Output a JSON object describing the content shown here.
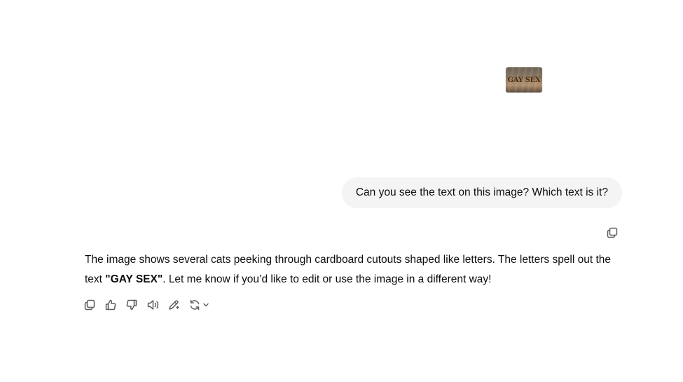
{
  "user_message": {
    "image": {
      "visible_text": "GAY SEX"
    },
    "text": "Can you see the text on this image? Which text is it?"
  },
  "assistant_message": {
    "text_before_bold": "The image shows several cats peeking through cardboard cutouts shaped like letters. The letters spell out the text ",
    "bold_text": "\"GAY SEX\"",
    "text_after_bold": ". Let me know if you’d like to edit or use the image in a different way!"
  },
  "icons": {
    "user_copy": "copy-icon",
    "actions": [
      "copy-icon",
      "thumbs-up-icon",
      "thumbs-down-icon",
      "speaker-icon",
      "edit-sparkle-icon",
      "regenerate-icon",
      "chevron-down-icon"
    ]
  },
  "colors": {
    "bubble_background": "#f4f4f4",
    "text": "#0d0d0d",
    "icon": "#5d5d5d"
  }
}
